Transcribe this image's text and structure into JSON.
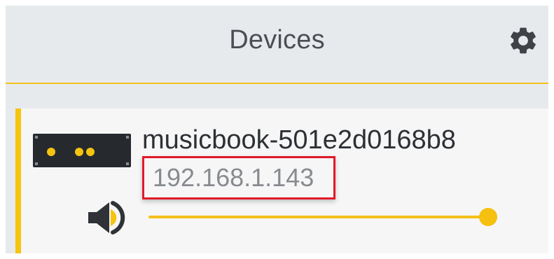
{
  "header": {
    "title": "Devices",
    "settings_icon": "gear-icon"
  },
  "colors": {
    "accent": "#f5c40f",
    "highlight_border": "#e11a2a",
    "background": "#e7eaed",
    "card": "#f6f6f6"
  },
  "device": {
    "name": "musicbook-501e2d0168b8",
    "ip": "192.168.1.143",
    "icon": "speaker-device-icon",
    "volume_icon": "speaker-volume-icon",
    "volume_level": 1.0
  }
}
